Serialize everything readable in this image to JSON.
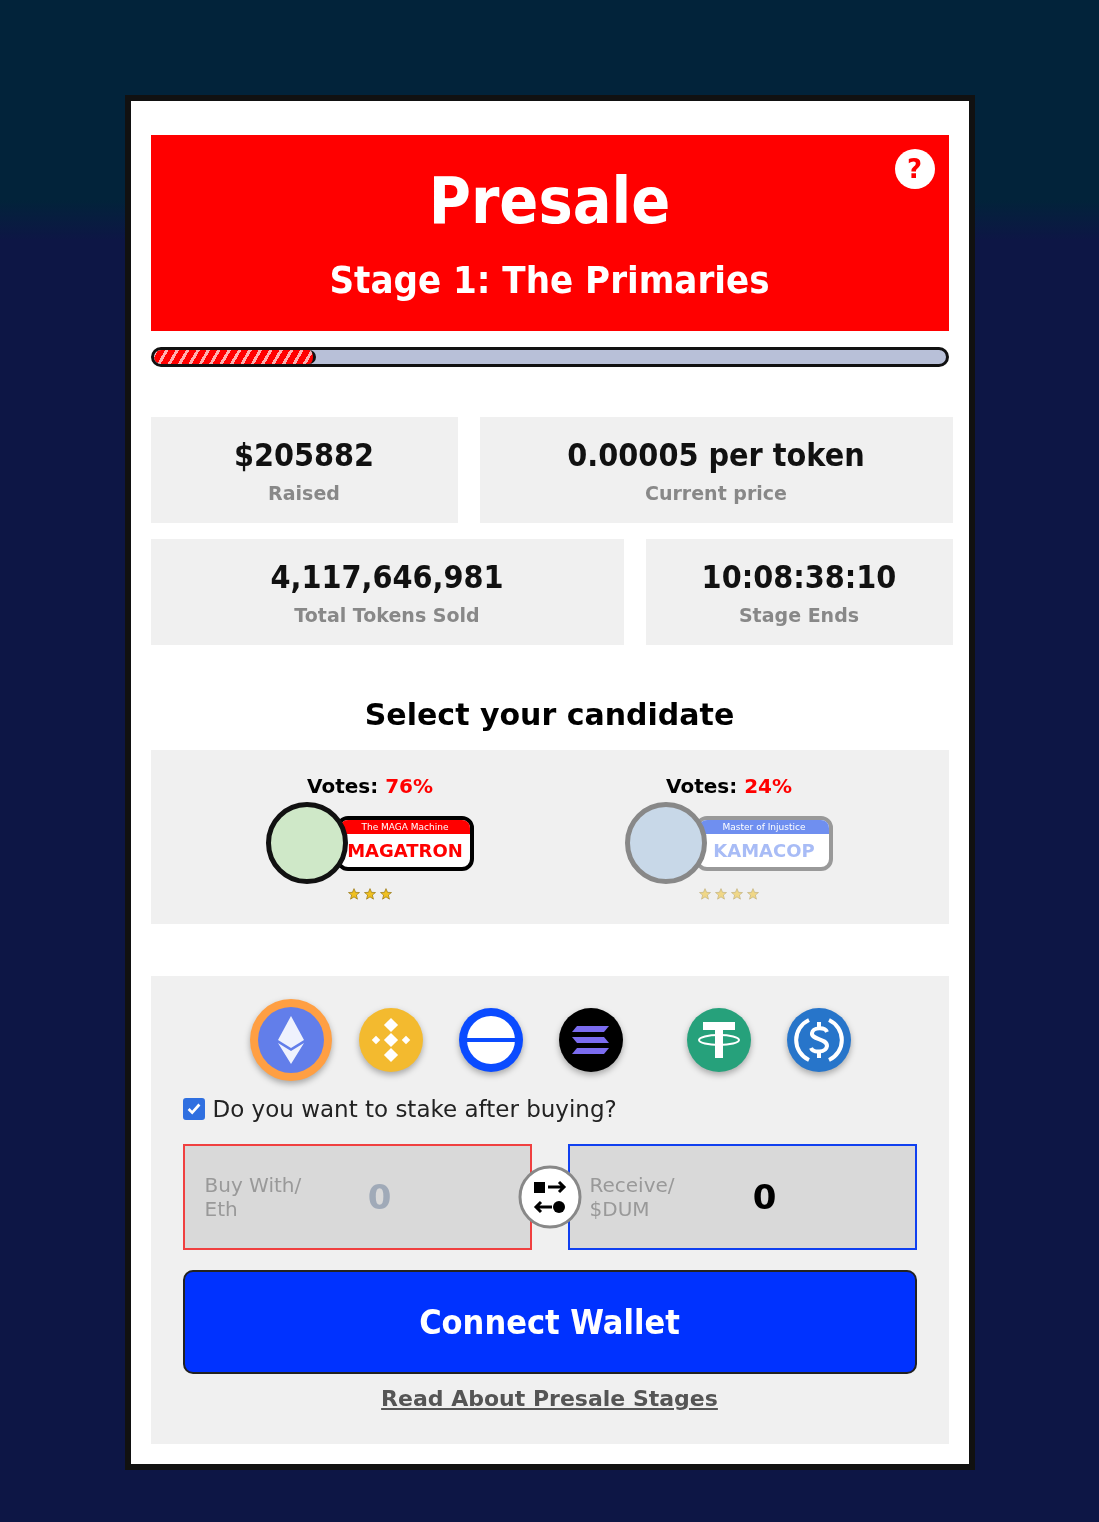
{
  "header": {
    "title": "Presale",
    "subtitle": "Stage 1: The Primaries",
    "help": "?"
  },
  "progress": {
    "level": 0.205
  },
  "stats": [
    {
      "value": "$205882",
      "label": "Raised"
    },
    {
      "value": "0.00005 per token",
      "label": "Current price"
    },
    {
      "value": "4,117,646,981",
      "label": "Total Tokens Sold"
    },
    {
      "value": "10:08:38:10",
      "label": "Stage Ends"
    }
  ],
  "candidates_title": "Select your candidate",
  "candidates": [
    {
      "votes_label": "Votes:",
      "votes": "76%",
      "tagline": "The MAGA Machine",
      "name": "MAGATRON",
      "stars": 3,
      "selected": true,
      "color": "#ff0000"
    },
    {
      "votes_label": "Votes:",
      "votes": "24%",
      "tagline": "Master of Injustice",
      "name": "KAMACOP",
      "stars": 4,
      "selected": false,
      "color": "#6f8ff0"
    }
  ],
  "currencies": [
    {
      "kind": "eth",
      "selected": true
    },
    {
      "kind": "bnb",
      "selected": false
    },
    {
      "kind": "ring",
      "selected": false
    },
    {
      "kind": "sol",
      "selected": false
    },
    {
      "kind": "tether",
      "selected": false
    },
    {
      "kind": "usdc",
      "selected": false
    }
  ],
  "stake": {
    "label": "Do you want to stake after buying?",
    "checked": true
  },
  "buy": {
    "label": "Buy With/ Eth",
    "placeholder": "0"
  },
  "receive": {
    "label": "Receive/ $DUM",
    "value": "0"
  },
  "connect_button": "Connect Wallet",
  "link": "Read About Presale Stages"
}
